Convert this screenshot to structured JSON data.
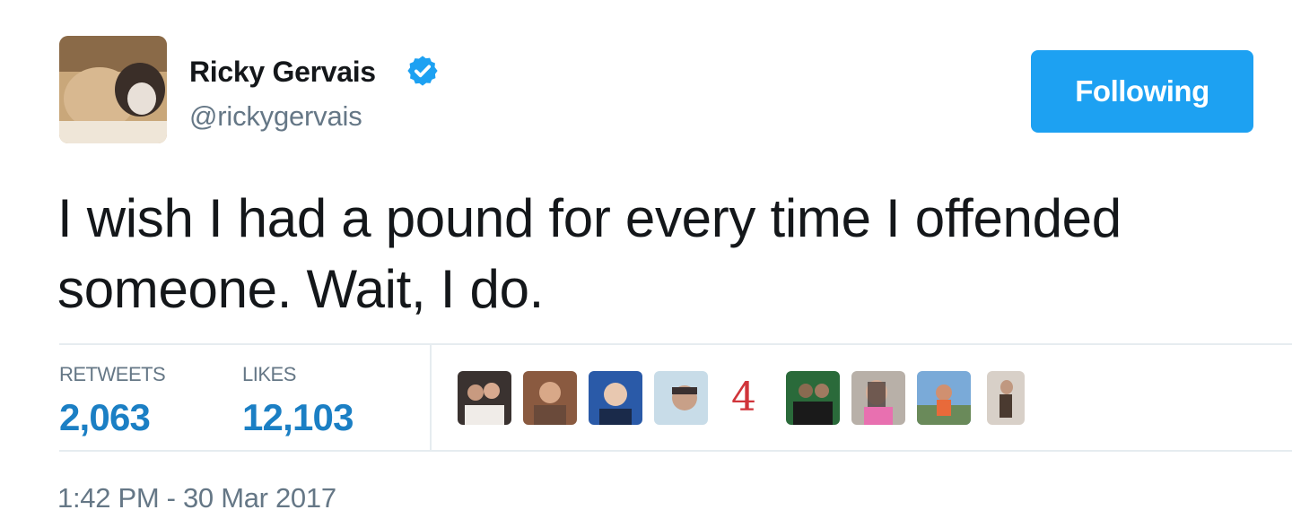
{
  "author": {
    "display_name": "Ricky Gervais",
    "handle": "@rickygervais",
    "verified": true
  },
  "follow_button": {
    "label": "Following"
  },
  "tweet": {
    "line1": "I wish I had a pound for every time I offended",
    "line2": "someone. Wait, I do."
  },
  "stats": {
    "retweets_label": "RETWEETS",
    "retweets_value": "2,063",
    "likes_label": "LIKES",
    "likes_value": "12,103"
  },
  "likers": {
    "count_badge": "4"
  },
  "timestamp": "1:42 PM - 30 Mar 2017",
  "colors": {
    "accent": "#1da1f2",
    "stat_value": "#1b7fc4",
    "secondary_text": "#657786",
    "divider": "#e6ecf0"
  }
}
